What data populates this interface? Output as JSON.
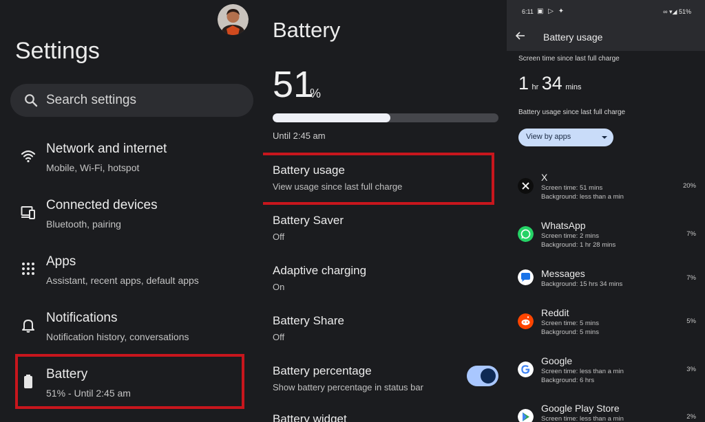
{
  "settings": {
    "title": "Settings",
    "search_placeholder": "Search settings",
    "items": [
      {
        "icon": "wifi-icon",
        "title": "Network and internet",
        "subtitle": "Mobile, Wi-Fi, hotspot"
      },
      {
        "icon": "connected-devices-icon",
        "title": "Connected devices",
        "subtitle": "Bluetooth, pairing"
      },
      {
        "icon": "apps-grid-icon",
        "title": "Apps",
        "subtitle": "Assistant, recent apps, default apps"
      },
      {
        "icon": "bell-icon",
        "title": "Notifications",
        "subtitle": "Notification history, conversations"
      },
      {
        "icon": "battery-icon",
        "title": "Battery",
        "subtitle": "51% - Until 2:45 am"
      }
    ]
  },
  "battery": {
    "title": "Battery",
    "percent": "51",
    "percent_unit": "%",
    "level_fraction": 0.52,
    "until": "Until 2:45 am",
    "items": [
      {
        "title": "Battery usage",
        "subtitle": "View usage since last full charge"
      },
      {
        "title": "Battery Saver",
        "subtitle": "Off"
      },
      {
        "title": "Adaptive charging",
        "subtitle": "On"
      },
      {
        "title": "Battery Share",
        "subtitle": "Off"
      },
      {
        "title": "Battery percentage",
        "subtitle": "Show battery percentage in status bar",
        "toggle_on": true
      },
      {
        "title": "Battery widget",
        "subtitle": ""
      }
    ]
  },
  "usage": {
    "status": {
      "time": "6:11",
      "battery": "51%"
    },
    "title": "Battery usage",
    "screen_time_label": "Screen time since last full charge",
    "screen_time": {
      "hours": "1",
      "hours_unit": "hr",
      "mins": "34",
      "mins_unit": "mins"
    },
    "usage_label": "Battery usage since last full charge",
    "view_by": "View by apps",
    "apps": [
      {
        "name": "X",
        "line1": "Screen time: 51 mins",
        "line2": "Background: less than a min",
        "percent": "20%",
        "icon": "x-app-icon"
      },
      {
        "name": "WhatsApp",
        "line1": "Screen time: 2 mins",
        "line2": "Background: 1 hr 28 mins",
        "percent": "7%",
        "icon": "whatsapp-app-icon"
      },
      {
        "name": "Messages",
        "line1": "Background: 15 hrs 34 mins",
        "line2": "",
        "percent": "7%",
        "icon": "messages-app-icon"
      },
      {
        "name": "Reddit",
        "line1": "Screen time: 5 mins",
        "line2": "Background: 5 mins",
        "percent": "5%",
        "icon": "reddit-app-icon"
      },
      {
        "name": "Google",
        "line1": "Screen time: less than a min",
        "line2": "Background: 6 hrs",
        "percent": "3%",
        "icon": "google-app-icon"
      },
      {
        "name": "Google Play Store",
        "line1": "Screen time: less than a min",
        "line2": "",
        "percent": "2%",
        "icon": "play-store-app-icon"
      }
    ]
  },
  "colors": {
    "background": "#1b1c1f",
    "highlight": "#c8161d",
    "toggle": "#a9c7ff",
    "chip": "#c9dcf9"
  }
}
